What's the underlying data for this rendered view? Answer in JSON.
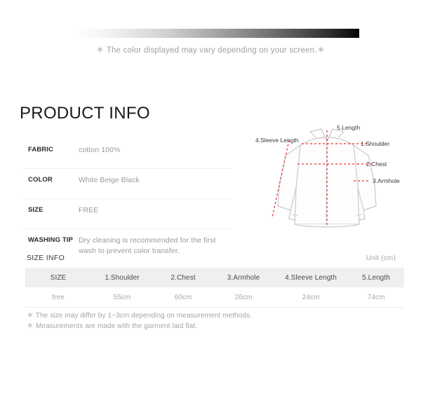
{
  "color_strip": {
    "caption": "＊ The color displayed may vary depending on your screen.＊",
    "gradient_from": "#ffffff",
    "gradient_to": "#050505"
  },
  "page_title": "PRODUCT INFO",
  "specs": [
    {
      "label": "FABRIC",
      "value": "cotton 100%"
    },
    {
      "label": "COLOR",
      "value": "White Beige Black"
    },
    {
      "label": "SIZE",
      "value": "FREE"
    },
    {
      "label": "WASHING TIP",
      "value": "Dry cleaning is recommended for the first wash to prevent color transfer."
    }
  ],
  "diagram": {
    "measure_color": "#ee3333",
    "outline_color": "#c9c9c9",
    "callouts": [
      {
        "id": "sleeve-length",
        "text": "4.Sleeve Length"
      },
      {
        "id": "length",
        "text": "5.Length"
      },
      {
        "id": "shoulder",
        "text": "1.Shoulder"
      },
      {
        "id": "chest",
        "text": "2.Chest"
      },
      {
        "id": "armhole",
        "text": "3.Armhole"
      }
    ]
  },
  "size_info": {
    "title": "SIZE INFO",
    "unit": "Unit (cm)",
    "columns": [
      "SIZE",
      "1.Shoulder",
      "2.Chest",
      "3.Armhole",
      "4.Sleeve Length",
      "5.Length"
    ],
    "rows": [
      [
        "free",
        "55cm",
        "60cm",
        "26cm",
        "24cm",
        "74cm"
      ]
    ]
  },
  "notes": [
    "＊ The size may differ by 1~3cm depending on measurement methods.",
    "＊ Measurements are made with the garment laid flat."
  ]
}
